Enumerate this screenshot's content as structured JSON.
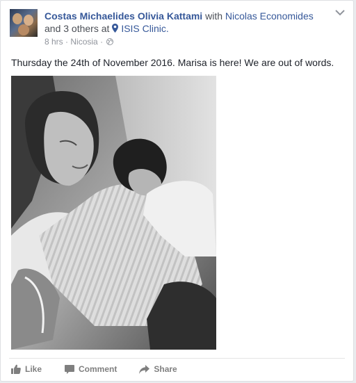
{
  "post": {
    "author": "Costas Michaelides Olivia Kattami",
    "with_text": "with",
    "tagged_person": "Nicolas Economides",
    "and_text": "and",
    "others": "3 others",
    "at_text": "at",
    "place": "ISIS Clinic.",
    "time": "8 hrs",
    "separator": "·",
    "location": "Nicosia",
    "separator2": "·",
    "audience_icon": "globe-icon",
    "text": "Thursday the 24th of November 2016. Marisa is here! We are out of words."
  },
  "actions": {
    "like_label": "Like",
    "comment_label": "Comment",
    "share_label": "Share"
  },
  "colors": {
    "link": "#365899",
    "text": "#1d2129",
    "muted": "#90949c",
    "action": "#7f7f7f"
  }
}
